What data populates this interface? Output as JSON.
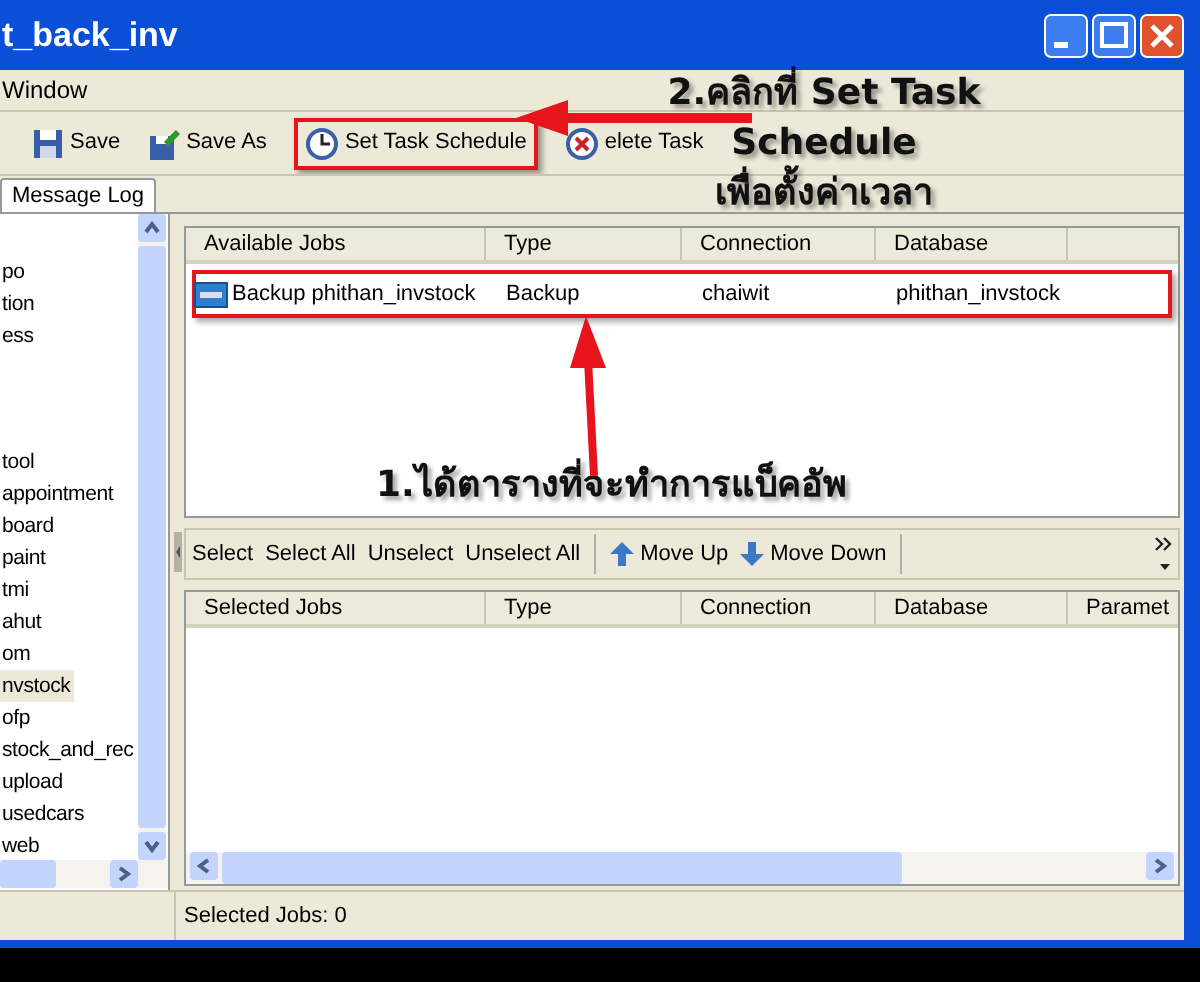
{
  "window": {
    "title": "t_back_inv"
  },
  "menu": [
    "Window"
  ],
  "toolbar": [
    {
      "label": "Save",
      "kind": "save",
      "highlighted": false
    },
    {
      "label": "Save As",
      "kind": "save_as",
      "highlighted": false
    },
    {
      "label": "Set Task Schedule",
      "kind": "clock",
      "highlighted": true
    },
    {
      "label": "elete Task",
      "kind": "delete",
      "highlighted": false
    }
  ],
  "tabs": [
    {
      "label": "Message Log",
      "selected": true
    }
  ],
  "sidebar": {
    "items": [
      {
        "label": "po",
        "selected": false
      },
      {
        "label": "tion",
        "selected": false
      },
      {
        "label": "ess",
        "selected": false
      },
      {
        "label": "tool",
        "selected": false
      },
      {
        "label": "appointment",
        "selected": false
      },
      {
        "label": "board",
        "selected": false
      },
      {
        "label": "paint",
        "selected": false
      },
      {
        "label": "tmi",
        "selected": false
      },
      {
        "label": "ahut",
        "selected": false
      },
      {
        "label": "om",
        "selected": false
      },
      {
        "label": "nvstock",
        "selected": true
      },
      {
        "label": "ofp",
        "selected": false
      },
      {
        "label": "stock_and_rec",
        "selected": false
      },
      {
        "label": "upload",
        "selected": false
      },
      {
        "label": "usedcars",
        "selected": false
      },
      {
        "label": "web",
        "selected": false
      }
    ]
  },
  "available_jobs": {
    "columns": [
      "Available Jobs",
      "Type",
      "Connection",
      "Database"
    ],
    "rows": [
      {
        "cells": [
          "Backup phithan_invstock",
          "Backup",
          "chaiwit",
          "phithan_invstock"
        ],
        "highlighted": true
      }
    ]
  },
  "selection_toolbar": {
    "buttons": [
      "Select",
      "Select All",
      "Unselect",
      "Unselect All"
    ],
    "move_buttons": [
      {
        "label": "Move Up",
        "kind": "up"
      },
      {
        "label": "Move Down",
        "kind": "down"
      }
    ]
  },
  "selected_jobs": {
    "columns": [
      "Selected Jobs",
      "Type",
      "Connection",
      "Database",
      "Paramet"
    ]
  },
  "status_bar": {
    "text": "Selected Jobs: 0"
  },
  "annotations": [
    {
      "lines": [
        "2.คลิกที่ Set Task",
        "Schedule",
        "เพื่อตั้งค่าเวลา"
      ]
    },
    {
      "lines": [
        "1.ได้ตารางที่จะทำการแบ็คอัพ"
      ]
    }
  ]
}
